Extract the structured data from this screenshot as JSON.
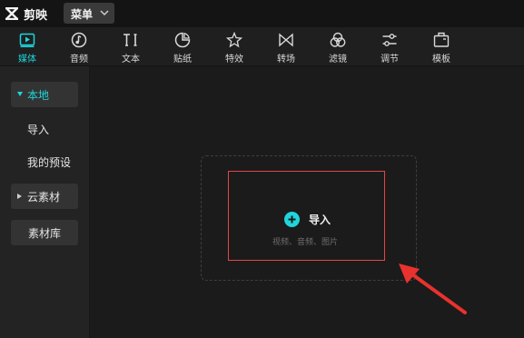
{
  "app": {
    "name": "剪映",
    "menu_label": "菜单"
  },
  "toolbar": {
    "items": [
      {
        "label": "媒体",
        "icon": "media-icon",
        "active": true
      },
      {
        "label": "音频",
        "icon": "audio-icon",
        "active": false
      },
      {
        "label": "文本",
        "icon": "text-icon",
        "active": false
      },
      {
        "label": "贴纸",
        "icon": "sticker-icon",
        "active": false
      },
      {
        "label": "特效",
        "icon": "effects-icon",
        "active": false
      },
      {
        "label": "转场",
        "icon": "transition-icon",
        "active": false
      },
      {
        "label": "滤镜",
        "icon": "filter-icon",
        "active": false
      },
      {
        "label": "调节",
        "icon": "adjust-icon",
        "active": false
      },
      {
        "label": "模板",
        "icon": "template-icon",
        "active": false
      }
    ]
  },
  "sidebar": {
    "items": [
      {
        "label": "本地",
        "expanded": true,
        "active": true
      },
      {
        "label": "导入"
      },
      {
        "label": "我的预设"
      },
      {
        "label": "云素材",
        "expanded": false
      },
      {
        "label": "素材库"
      }
    ]
  },
  "main": {
    "import_label": "导入",
    "import_hint": "视频、音频、图片"
  },
  "colors": {
    "accent": "#1fd5db",
    "highlight_box": "#e64646",
    "background": "#1b1b1b"
  }
}
